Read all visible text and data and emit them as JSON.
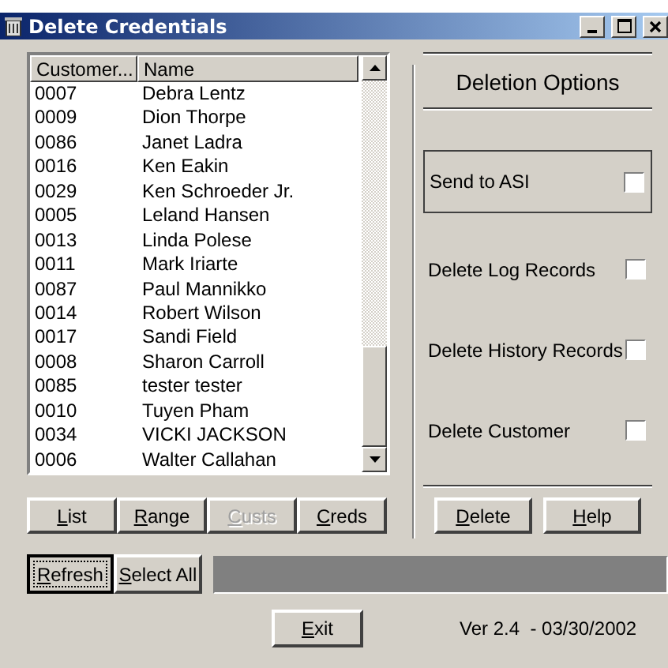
{
  "window": {
    "title": "Delete Credentials"
  },
  "list": {
    "columns": [
      "Customer...",
      "Name"
    ],
    "rows": [
      {
        "id": "0007",
        "name": "Debra Lentz"
      },
      {
        "id": "0009",
        "name": "Dion Thorpe"
      },
      {
        "id": "0086",
        "name": "Janet Ladra"
      },
      {
        "id": "0016",
        "name": "Ken Eakin"
      },
      {
        "id": "0029",
        "name": "Ken Schroeder Jr."
      },
      {
        "id": "0005",
        "name": "Leland Hansen"
      },
      {
        "id": "0013",
        "name": "Linda Polese"
      },
      {
        "id": "0011",
        "name": "Mark Iriarte"
      },
      {
        "id": "0087",
        "name": "Paul Mannikko"
      },
      {
        "id": "0014",
        "name": "Robert Wilson"
      },
      {
        "id": "0017",
        "name": "Sandi Field"
      },
      {
        "id": "0008",
        "name": "Sharon Carroll"
      },
      {
        "id": "0085",
        "name": "tester tester"
      },
      {
        "id": "0010",
        "name": "Tuyen Pham"
      },
      {
        "id": "0034",
        "name": "VICKI JACKSON"
      },
      {
        "id": "0006",
        "name": "Walter Callahan"
      }
    ]
  },
  "list_buttons": [
    {
      "label": "List",
      "disabled": false
    },
    {
      "label": "Range",
      "disabled": false
    },
    {
      "label": "Custs",
      "disabled": true
    },
    {
      "label": "Creds",
      "disabled": false
    }
  ],
  "refresh_buttons": [
    {
      "label": "Refresh",
      "focused": true
    },
    {
      "label": "Select All",
      "focused": false
    }
  ],
  "exit_button": "Exit",
  "options": {
    "title": "Deletion Options",
    "items": [
      {
        "label": "Send to ASI",
        "checked": false,
        "framed": true
      },
      {
        "label": "Delete Log Records",
        "checked": false,
        "framed": false
      },
      {
        "label": "Delete History Records",
        "checked": false,
        "framed": false
      },
      {
        "label": "Delete Customer",
        "checked": false,
        "framed": false
      }
    ],
    "buttons": [
      "Delete",
      "Help"
    ]
  },
  "version": "Ver 2.4  - 03/30/2002"
}
